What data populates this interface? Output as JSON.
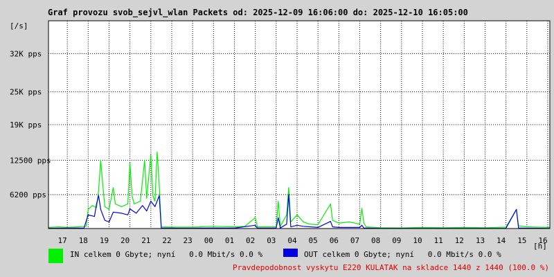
{
  "chart_data": {
    "type": "line",
    "title": "Graf provozu svob_sejvl_wlan Packets od: 2025-12-09 16:06:00 do: 2025-12-10 16:05:00",
    "ylabel": "[/s]",
    "xlabel": "[h]",
    "ylim": [
      0,
      38000
    ],
    "yticks": [
      {
        "value": 6200,
        "label": "6200 pps"
      },
      {
        "value": 12500,
        "label": "12500 pps"
      },
      {
        "value": 19000,
        "label": "19K pps"
      },
      {
        "value": 25000,
        "label": "25K pps"
      },
      {
        "value": 32000,
        "label": "32K pps"
      }
    ],
    "xlim": [
      16.1,
      40.1
    ],
    "xticks": [
      {
        "value": 17,
        "label": "17"
      },
      {
        "value": 18,
        "label": "18"
      },
      {
        "value": 19,
        "label": "19"
      },
      {
        "value": 20,
        "label": "20"
      },
      {
        "value": 21,
        "label": "21"
      },
      {
        "value": 22,
        "label": "22"
      },
      {
        "value": 23,
        "label": "23"
      },
      {
        "value": 24,
        "label": "00"
      },
      {
        "value": 25,
        "label": "01"
      },
      {
        "value": 26,
        "label": "02"
      },
      {
        "value": 27,
        "label": "03"
      },
      {
        "value": 28,
        "label": "04"
      },
      {
        "value": 29,
        "label": "05"
      },
      {
        "value": 30,
        "label": "06"
      },
      {
        "value": 31,
        "label": "07"
      },
      {
        "value": 32,
        "label": "08"
      },
      {
        "value": 33,
        "label": "09"
      },
      {
        "value": 34,
        "label": "10"
      },
      {
        "value": 35,
        "label": "11"
      },
      {
        "value": 36,
        "label": "12"
      },
      {
        "value": 37,
        "label": "13"
      },
      {
        "value": 38,
        "label": "14"
      },
      {
        "value": 39,
        "label": "15"
      },
      {
        "value": 40,
        "label": "16"
      }
    ],
    "grid": true,
    "series": [
      {
        "name": "IN",
        "color": "#00f000",
        "points": [
          [
            16.1,
            200
          ],
          [
            16.6,
            300
          ],
          [
            17.0,
            200
          ],
          [
            17.5,
            300
          ],
          [
            17.9,
            400
          ],
          [
            18.0,
            3500
          ],
          [
            18.2,
            4200
          ],
          [
            18.4,
            3800
          ],
          [
            18.5,
            7000
          ],
          [
            18.6,
            12500
          ],
          [
            18.7,
            8000
          ],
          [
            18.8,
            4000
          ],
          [
            19.0,
            3500
          ],
          [
            19.2,
            7500
          ],
          [
            19.3,
            4500
          ],
          [
            19.6,
            4000
          ],
          [
            19.9,
            4500
          ],
          [
            20.0,
            12000
          ],
          [
            20.1,
            6000
          ],
          [
            20.2,
            4500
          ],
          [
            20.5,
            5000
          ],
          [
            20.7,
            12500
          ],
          [
            20.8,
            5500
          ],
          [
            21.0,
            13500
          ],
          [
            21.1,
            6000
          ],
          [
            21.2,
            5000
          ],
          [
            21.3,
            14000
          ],
          [
            21.4,
            8000
          ],
          [
            21.5,
            300
          ],
          [
            22.0,
            250
          ],
          [
            23.0,
            250
          ],
          [
            24.0,
            400
          ],
          [
            25.0,
            300
          ],
          [
            25.5,
            400
          ],
          [
            26.0,
            2000
          ],
          [
            26.1,
            300
          ],
          [
            26.5,
            300
          ],
          [
            27.0,
            300
          ],
          [
            27.1,
            5000
          ],
          [
            27.2,
            400
          ],
          [
            27.5,
            2500
          ],
          [
            27.6,
            7500
          ],
          [
            27.7,
            1200
          ],
          [
            28.0,
            2500
          ],
          [
            28.3,
            1200
          ],
          [
            28.6,
            800
          ],
          [
            29.0,
            700
          ],
          [
            29.6,
            4500
          ],
          [
            29.7,
            1500
          ],
          [
            30.0,
            1000
          ],
          [
            30.5,
            1200
          ],
          [
            31.0,
            800
          ],
          [
            31.1,
            3700
          ],
          [
            31.2,
            1000
          ],
          [
            31.3,
            300
          ],
          [
            32.0,
            150
          ],
          [
            33.0,
            120
          ],
          [
            34.0,
            200
          ],
          [
            35.0,
            150
          ],
          [
            36.0,
            200
          ],
          [
            37.0,
            150
          ],
          [
            38.0,
            250
          ],
          [
            38.5,
            3500
          ],
          [
            38.6,
            500
          ],
          [
            39.0,
            300
          ],
          [
            39.5,
            250
          ],
          [
            40.1,
            200
          ]
        ]
      },
      {
        "name": "OUT",
        "color": "#0000e0",
        "points": [
          [
            16.1,
            50
          ],
          [
            17.0,
            80
          ],
          [
            17.8,
            100
          ],
          [
            18.0,
            2500
          ],
          [
            18.3,
            2200
          ],
          [
            18.4,
            4500
          ],
          [
            18.5,
            6000
          ],
          [
            18.6,
            3500
          ],
          [
            18.8,
            1500
          ],
          [
            19.0,
            1200
          ],
          [
            19.2,
            3000
          ],
          [
            19.6,
            2800
          ],
          [
            19.9,
            2500
          ],
          [
            20.0,
            3600
          ],
          [
            20.3,
            2800
          ],
          [
            20.6,
            4200
          ],
          [
            20.8,
            3200
          ],
          [
            21.0,
            5000
          ],
          [
            21.2,
            4000
          ],
          [
            21.4,
            6000
          ],
          [
            21.5,
            100
          ],
          [
            22.0,
            80
          ],
          [
            23.0,
            60
          ],
          [
            24.0,
            100
          ],
          [
            25.0,
            80
          ],
          [
            26.0,
            600
          ],
          [
            26.1,
            80
          ],
          [
            27.0,
            100
          ],
          [
            27.1,
            2000
          ],
          [
            27.2,
            100
          ],
          [
            27.5,
            800
          ],
          [
            27.6,
            6200
          ],
          [
            27.7,
            300
          ],
          [
            28.0,
            600
          ],
          [
            28.3,
            400
          ],
          [
            29.0,
            200
          ],
          [
            29.6,
            1300
          ],
          [
            29.7,
            300
          ],
          [
            30.0,
            200
          ],
          [
            31.0,
            200
          ],
          [
            31.1,
            600
          ],
          [
            31.2,
            100
          ],
          [
            32.0,
            40
          ],
          [
            35.0,
            40
          ],
          [
            38.0,
            50
          ],
          [
            38.5,
            3500
          ],
          [
            38.6,
            100
          ],
          [
            39.0,
            60
          ],
          [
            40.1,
            40
          ]
        ]
      }
    ]
  },
  "legend": {
    "in": {
      "label": "IN celkem 0 Gbyte; nyní   0.0 Mbit/s 0.0 %",
      "color": "#00f000"
    },
    "out": {
      "label": "OUT celkem 0 Gbyte; nyní   0.0 Mbit/s 0.0 %",
      "color": "#0000e0"
    }
  },
  "footer": "Pravdepodobnost vyskytu E220 KULATAK na skladce 1440 z 1440 (100.0 %)"
}
